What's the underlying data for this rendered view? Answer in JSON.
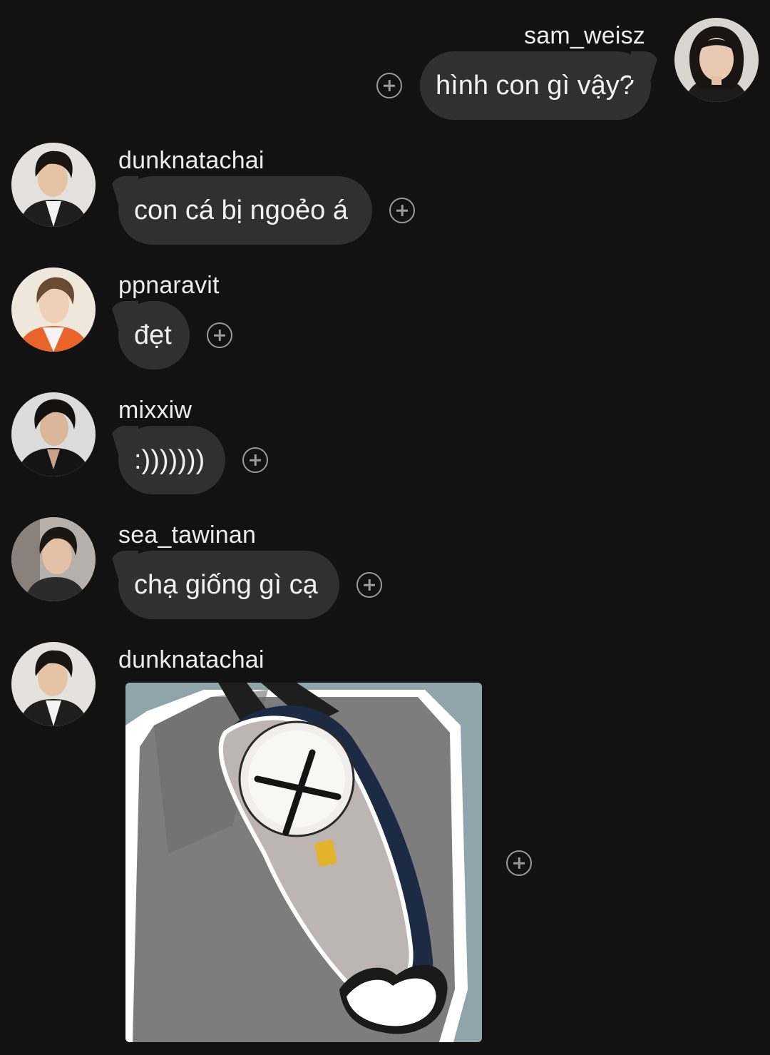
{
  "messages": [
    {
      "user": "sam_weisz",
      "text": "hình con gì vậy?",
      "side": "right"
    },
    {
      "user": "dunknatachai",
      "text": "con cá bị ngoẻo á",
      "side": "left"
    },
    {
      "user": "ppnaravit",
      "text": "đẹt",
      "side": "left"
    },
    {
      "user": "mixxiw",
      "text": ":)))))))",
      "side": "left"
    },
    {
      "user": "sea_tawinan",
      "text": "chạ giống gì cạ",
      "side": "left"
    },
    {
      "user": "dunknatachai",
      "type": "image",
      "image_desc": "gray fish-shaped sling bag worn on a gray sweater",
      "side": "left"
    }
  ],
  "icons": {
    "reaction": "add-reaction-icon"
  },
  "colors": {
    "background": "#121212",
    "bubble": "#303030",
    "text": "#f1f1f1"
  }
}
